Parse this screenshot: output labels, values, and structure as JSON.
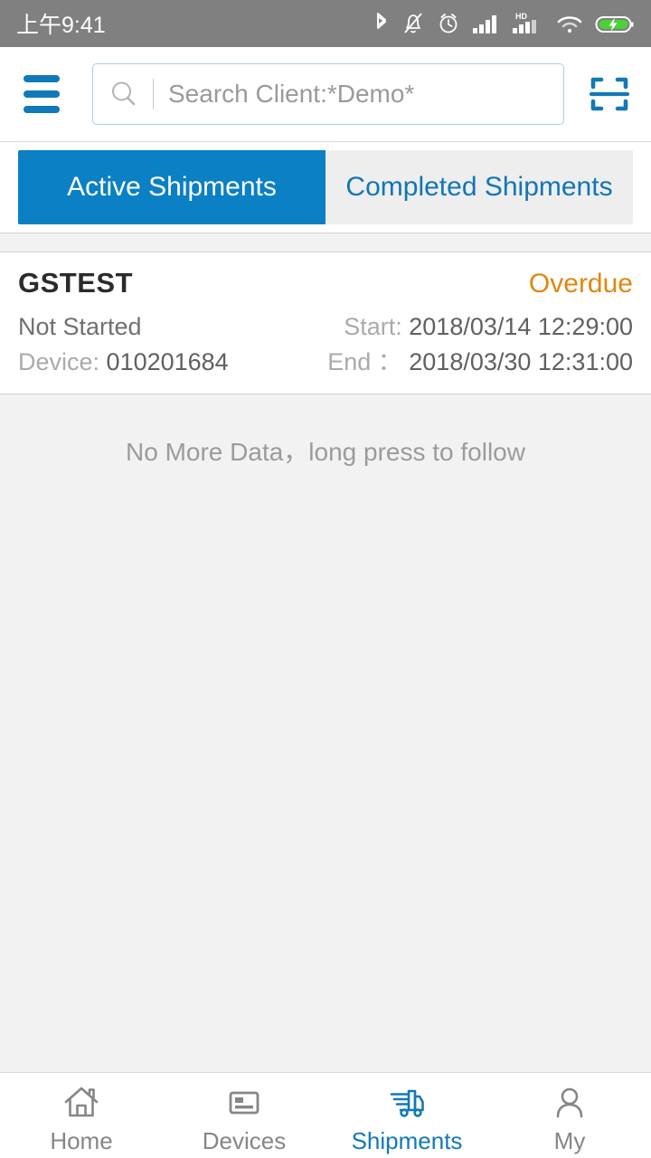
{
  "status_bar": {
    "time": "上午9:41",
    "icons": [
      "bluetooth-icon",
      "bell-muted-icon",
      "alarm-clock-icon",
      "signal-bars-icon",
      "hd-signal-icon",
      "wifi-icon",
      "battery-charging-icon"
    ],
    "background": "#808080",
    "foreground": "#ffffff",
    "battery_accent": "#4cd137"
  },
  "header": {
    "menu_icon": "hamburger-icon",
    "search": {
      "icon": "search-icon",
      "placeholder": "Search Client:*Demo*",
      "value": ""
    },
    "scan_icon": "scan-code-icon",
    "accent": "#1279b8"
  },
  "tabs": {
    "active_index": 0,
    "items": [
      {
        "label": "Active Shipments",
        "active": true
      },
      {
        "label": "Completed Shipments",
        "active": false
      }
    ],
    "active_bg": "#0b80c4",
    "inactive_bg": "#eeeeee",
    "inactive_text": "#1276b5"
  },
  "shipments": {
    "items": [
      {
        "title": "GSTEST",
        "status": "Overdue",
        "status_color": "#e2860f",
        "state": "Not Started",
        "device_label": "Device:",
        "device_value": "010201684",
        "start_label": "Start:",
        "start_value": "2018/03/14 12:29:00",
        "end_label": "End ：",
        "end_value": "2018/03/30 12:31:00"
      }
    ],
    "footer_text": "No More Data，long press to follow"
  },
  "bottom_nav": {
    "active_index": 2,
    "items": [
      {
        "label": "Home",
        "icon": "home-icon",
        "active": false
      },
      {
        "label": "Devices",
        "icon": "device-card-icon",
        "active": false
      },
      {
        "label": "Shipments",
        "icon": "truck-icon",
        "active": true
      },
      {
        "label": "My",
        "icon": "person-icon",
        "active": false
      }
    ],
    "active_color": "#1279b8",
    "inactive_color": "#868686"
  }
}
